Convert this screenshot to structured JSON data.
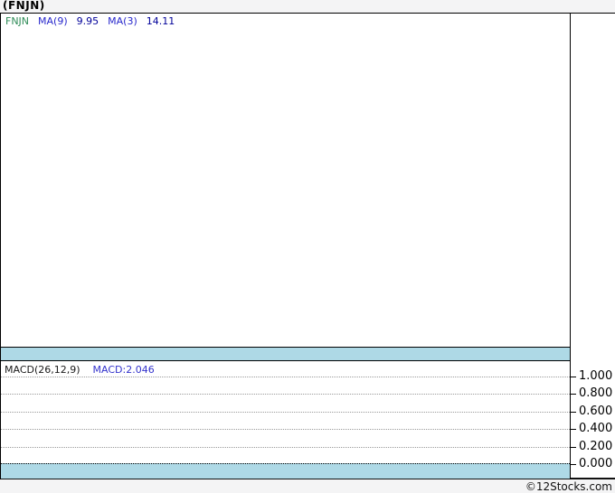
{
  "title": "(FNJN)",
  "price_panel": {
    "legend": {
      "symbol": "FNJN",
      "ma9_label": "MA(9)",
      "ma9_value": "9.95",
      "ma3_label": "MA(3)",
      "ma3_value": "14.11"
    }
  },
  "macd_panel": {
    "legend_label": "MACD(26,12,9)",
    "legend_value": "MACD:2.046",
    "axis_ticks": [
      "1.000",
      "0.800",
      "0.600",
      "0.400",
      "0.200",
      "0.000"
    ]
  },
  "footer": {
    "credit": "©12Stocks.com"
  },
  "colors": {
    "band_blue": "#aed9e6",
    "symbol_green": "#2e8b57",
    "ma_label_blue": "#2727cc",
    "ma_value_navy": "#000099",
    "macd_value_blue": "#3333cc",
    "page_background": "#f4f4f5",
    "panel_background": "#ffffff",
    "border_black": "#000000"
  },
  "chart_data": [
    {
      "type": "line",
      "title": "(FNJN) price panel",
      "series": [
        {
          "name": "FNJN",
          "values": []
        },
        {
          "name": "MA(9)",
          "last_value": 9.95,
          "values": []
        },
        {
          "name": "MA(3)",
          "last_value": 14.11,
          "values": []
        }
      ],
      "note": "price panel is rendered empty - no candles, lines or axis labels visible",
      "grid": "off",
      "legend_position": "top-left"
    },
    {
      "type": "line",
      "title": "MACD(26,12,9)",
      "series": [
        {
          "name": "MACD",
          "last_value": 2.046,
          "values": []
        }
      ],
      "ylabel": "",
      "yticks": [
        1.0,
        0.8,
        0.6,
        0.4,
        0.2,
        0.0
      ],
      "ylim_visible": [
        0.0,
        1.0
      ],
      "grid": "dotted horizontal gridlines at each ytick",
      "note": "no MACD curve visible inside the plotted range; light blue bands border the panel",
      "legend_position": "top-left"
    }
  ]
}
